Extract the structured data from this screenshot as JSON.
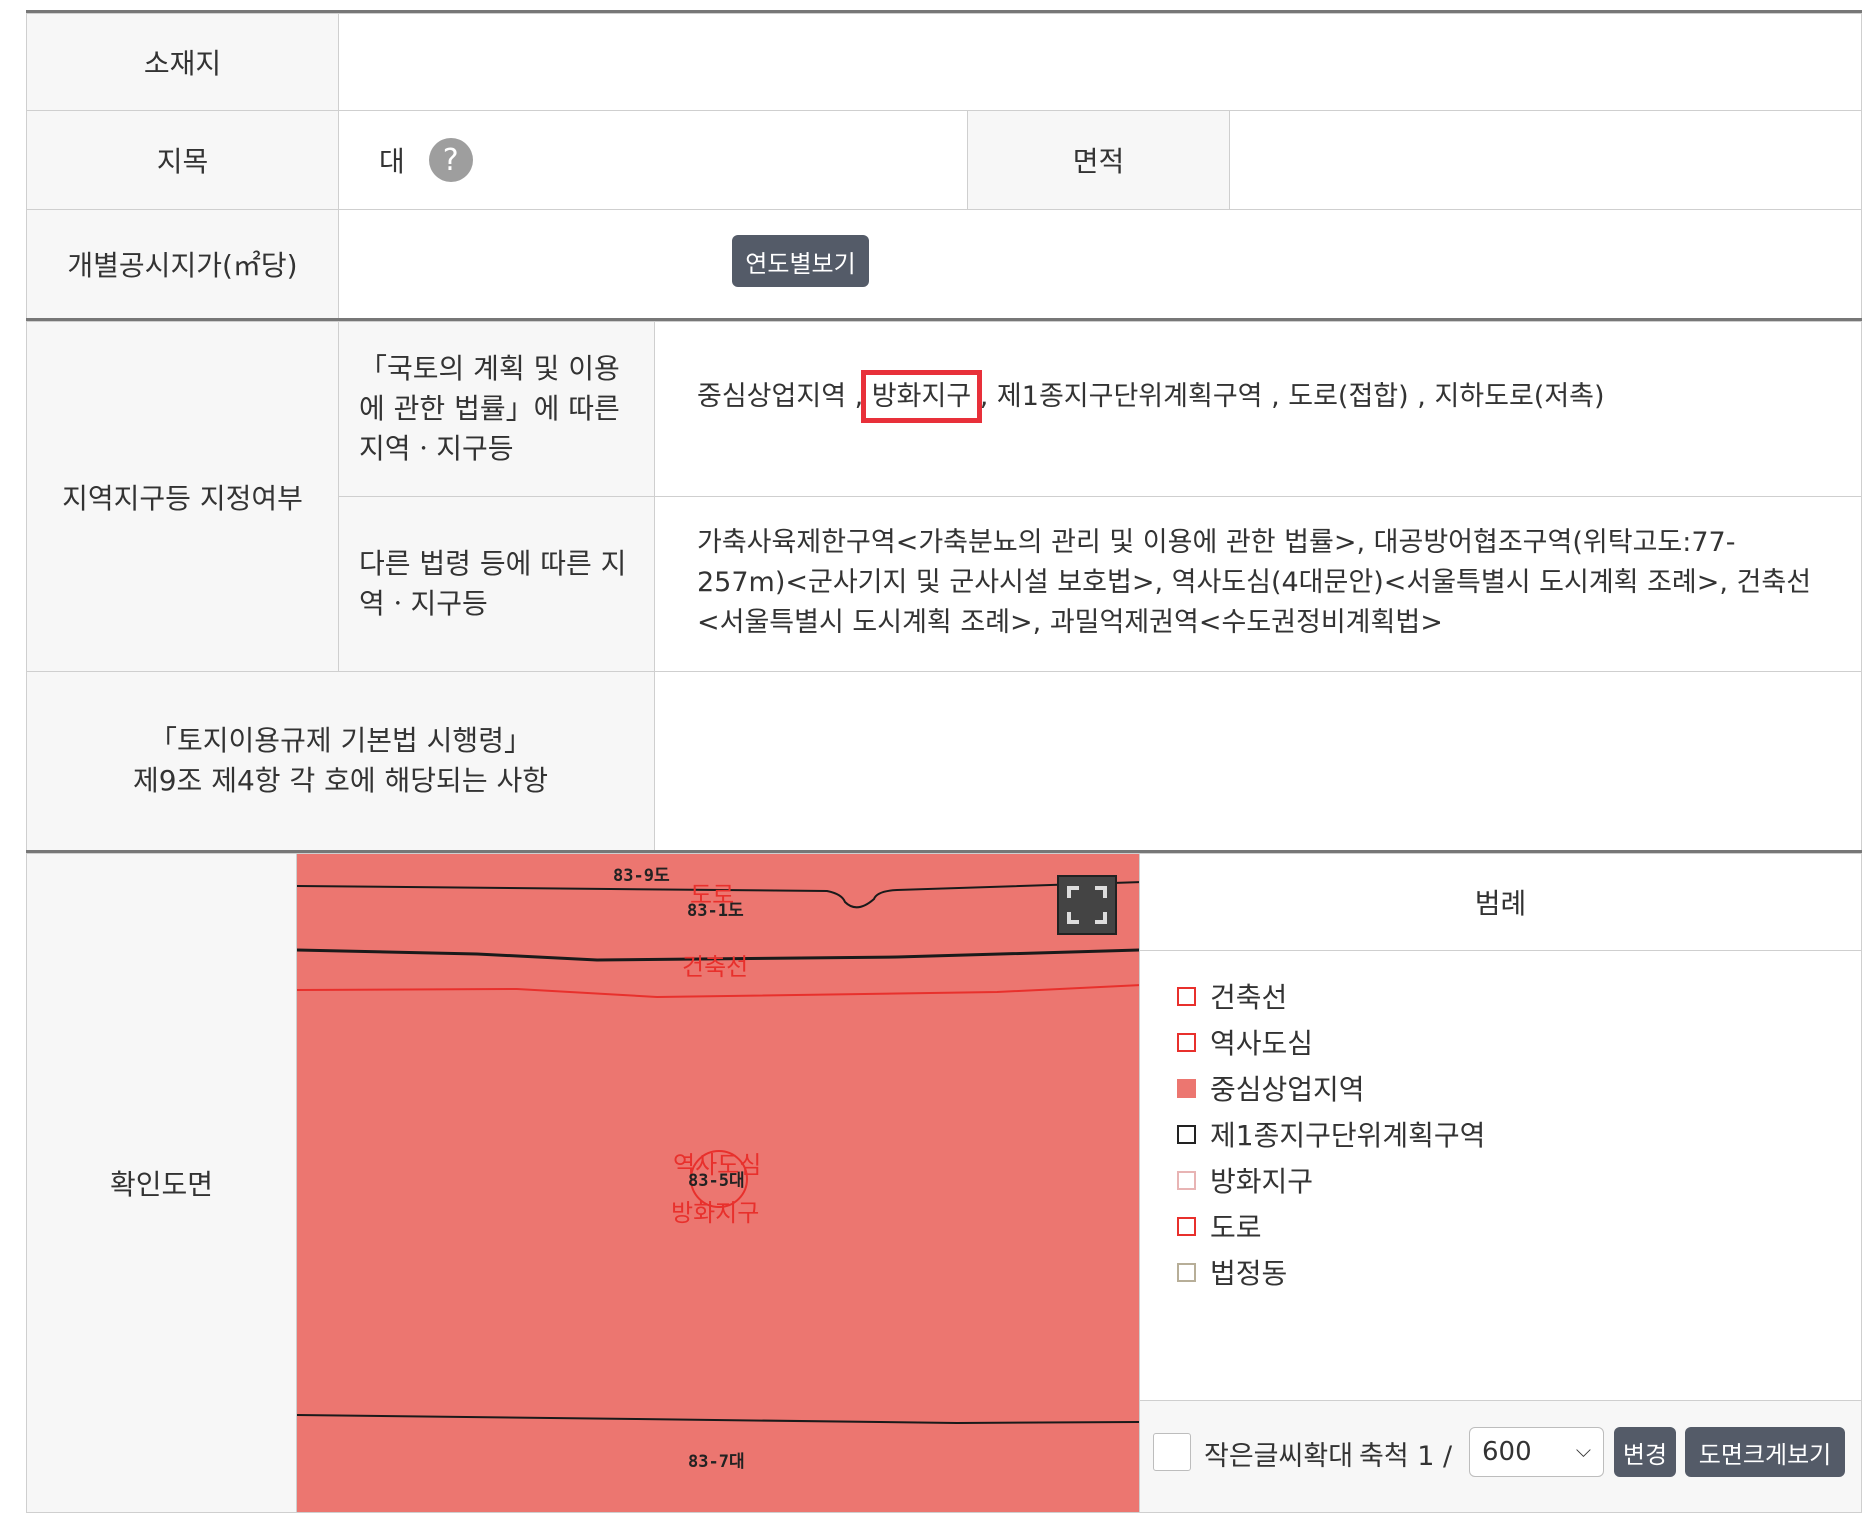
{
  "rows": {
    "location": {
      "label": "소재지",
      "value": ""
    },
    "land_category": {
      "label": "지목",
      "value": "대",
      "help": "?"
    },
    "area": {
      "label": "면적",
      "value": ""
    },
    "price": {
      "label": "개별공시지가(㎡당)",
      "button": "연도별보기"
    }
  },
  "zoning": {
    "label": "지역지구등 지정여부",
    "law1_label": "「국토의 계획 및 이용에 관한 법률」에 따른 지역ㆍ지구등",
    "law1_items": [
      "중심상업지역",
      "방화지구",
      "제1종지구단위계획구역",
      "도로(접합)",
      "지하도로(저촉)"
    ],
    "law1_separator": " , ",
    "law2_label": "다른 법령 등에 따른 지역ㆍ지구등",
    "law2_text": "가축사육제한구역<가축분뇨의 관리 및 이용에 관한 법률>, 대공방어협조구역(위탁고도:77-257m)<군사기지 및 군사시설 보호법>, 역사도심(4대문안)<서울특별시 도시계획 조례>, 건축선<서울특별시 도시계획 조례>, 과밀억제권역<수도권정비계획법>"
  },
  "enforcement": {
    "label_line1": "「토지이용규제 기본법 시행령」",
    "label_line2": "제9조 제4항 각 호에 해당되는 사항",
    "value": ""
  },
  "map": {
    "label": "확인도면",
    "parcels": [
      "83-9도",
      "83-1도",
      "83-5대",
      "83-7대"
    ],
    "zone_labels": [
      "도로",
      "건축선",
      "역사도심",
      "방화지구"
    ],
    "fill_color": "#ec7670"
  },
  "legend": {
    "title": "범례",
    "items": [
      {
        "label": "건축선",
        "style": "outline",
        "color": "#e8302c"
      },
      {
        "label": "역사도심",
        "style": "outline",
        "color": "#e8302c"
      },
      {
        "label": "중심상업지역",
        "style": "fill",
        "color": "#ec7670"
      },
      {
        "label": "제1종지구단위계획구역",
        "style": "outline",
        "color": "#222222"
      },
      {
        "label": "방화지구",
        "style": "outline",
        "color": "#e8b4b4"
      },
      {
        "label": "도로",
        "style": "outline",
        "color": "#e8302c"
      },
      {
        "label": "법정동",
        "style": "outline",
        "color": "#b7ae98"
      }
    ]
  },
  "controls": {
    "enlarge_label": "작은글씨확대",
    "scale_label": "축척 1 /",
    "scale_value": "600",
    "scale_options": [
      "600"
    ],
    "change_button": "변경",
    "bigmap_button": "도면크게보기"
  },
  "colors": {
    "highlight": "#e8303a",
    "button_bg": "#545b68"
  }
}
